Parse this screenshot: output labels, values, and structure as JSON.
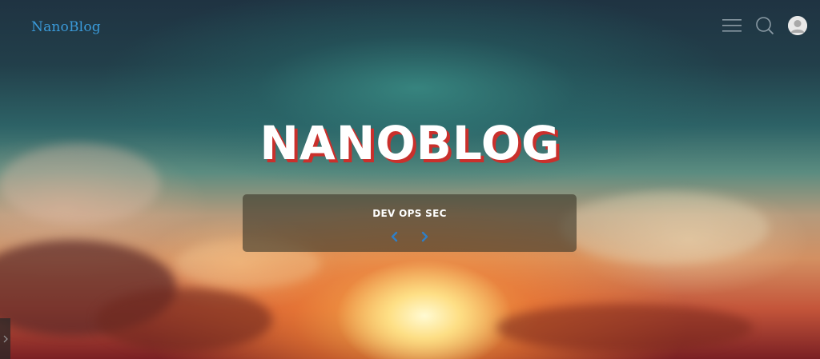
{
  "header": {
    "brand": "NanoBlog",
    "menu_icon": "hamburger-menu-icon",
    "search_icon": "search-icon",
    "avatar_icon": "user-avatar-icon"
  },
  "hero": {
    "title": "NANOBLOG",
    "slider": {
      "label": "DEV OPS SEC",
      "prev_icon": "chevron-left-icon",
      "next_icon": "chevron-right-icon"
    }
  },
  "sidebar": {
    "toggle_icon": "chevron-right-icon"
  },
  "colors": {
    "brand": "#3a9ad9",
    "title_shadow": "#c9302c",
    "arrow": "#2f7fc8"
  }
}
